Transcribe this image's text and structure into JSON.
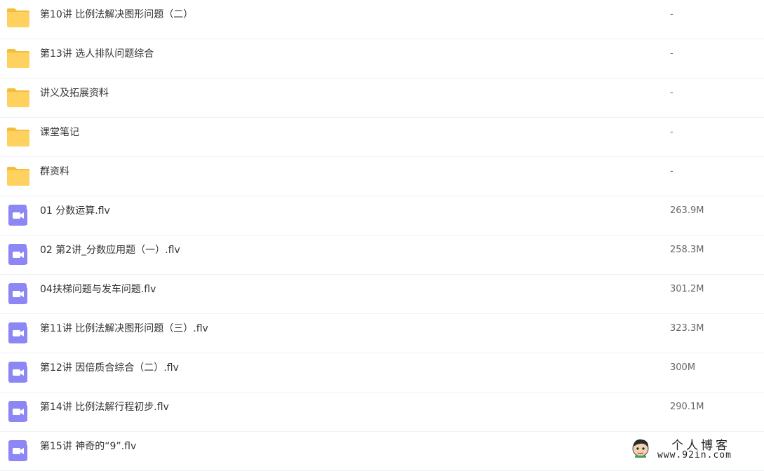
{
  "files": [
    {
      "type": "folder",
      "icon": "folder-icon",
      "name": "第10讲 比例法解决图形问题（二）",
      "size": "-"
    },
    {
      "type": "folder",
      "icon": "folder-icon",
      "name": "第13讲 选人排队问题综合",
      "size": "-"
    },
    {
      "type": "folder",
      "icon": "folder-icon",
      "name": "讲义及拓展资料",
      "size": "-"
    },
    {
      "type": "folder",
      "icon": "folder-icon",
      "name": "课堂笔记",
      "size": "-"
    },
    {
      "type": "folder",
      "icon": "folder-icon",
      "name": "群资料",
      "size": "-"
    },
    {
      "type": "video",
      "icon": "video-file-icon",
      "name": "01 分数运算.flv",
      "size": "263.9M"
    },
    {
      "type": "video",
      "icon": "video-file-icon",
      "name": "02 第2讲_分数应用题（一）.flv",
      "size": "258.3M"
    },
    {
      "type": "video",
      "icon": "video-file-icon",
      "name": "04扶梯问题与发车问题.flv",
      "size": "301.2M"
    },
    {
      "type": "video",
      "icon": "video-file-icon",
      "name": "第11讲 比例法解决图形问题（三）.flv",
      "size": "323.3M"
    },
    {
      "type": "video",
      "icon": "video-file-icon",
      "name": "第12讲 因倍质合综合（二）.flv",
      "size": "300M"
    },
    {
      "type": "video",
      "icon": "video-file-icon",
      "name": "第14讲 比例法解行程初步.flv",
      "size": "290.1M"
    },
    {
      "type": "video",
      "icon": "video-file-icon",
      "name": "第15讲 神奇的“9”.flv",
      "size": ""
    }
  ],
  "watermark": {
    "title": "个人博客",
    "url": "www.92in.com",
    "avatar_icon": "cartoon-avatar-icon"
  },
  "colors": {
    "folder": "#ffd25f",
    "folder_tab": "#f5bd3c",
    "video": "#8c87f5",
    "divider": "#eef0f4",
    "text": "#333333",
    "size_text": "#666666"
  }
}
